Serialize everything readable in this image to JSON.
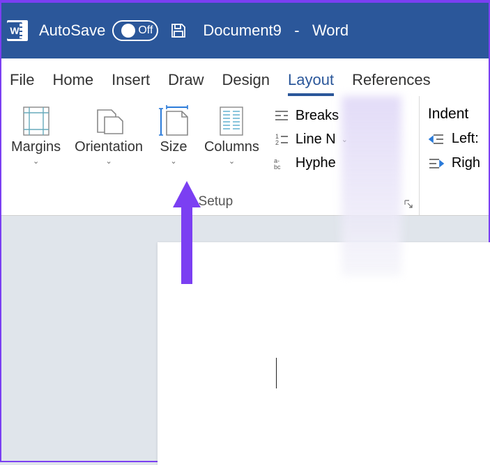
{
  "titlebar": {
    "autosave_label": "AutoSave",
    "autosave_state": "Off",
    "document_name": "Document9",
    "separator": "-",
    "app_name": "Word"
  },
  "tabs": [
    {
      "label": "File"
    },
    {
      "label": "Home"
    },
    {
      "label": "Insert"
    },
    {
      "label": "Draw"
    },
    {
      "label": "Design"
    },
    {
      "label": "Layout",
      "active": true
    },
    {
      "label": "References"
    }
  ],
  "ribbon": {
    "page_setup": {
      "margins": "Margins",
      "orientation": "Orientation",
      "size": "Size",
      "columns": "Columns",
      "breaks": "Breaks",
      "line_numbers": "Line N",
      "hyphenation": "Hyphe",
      "group_label": "e Setup"
    },
    "paragraph": {
      "indent_title": "Indent",
      "left": "Left:",
      "right": "Righ"
    }
  }
}
